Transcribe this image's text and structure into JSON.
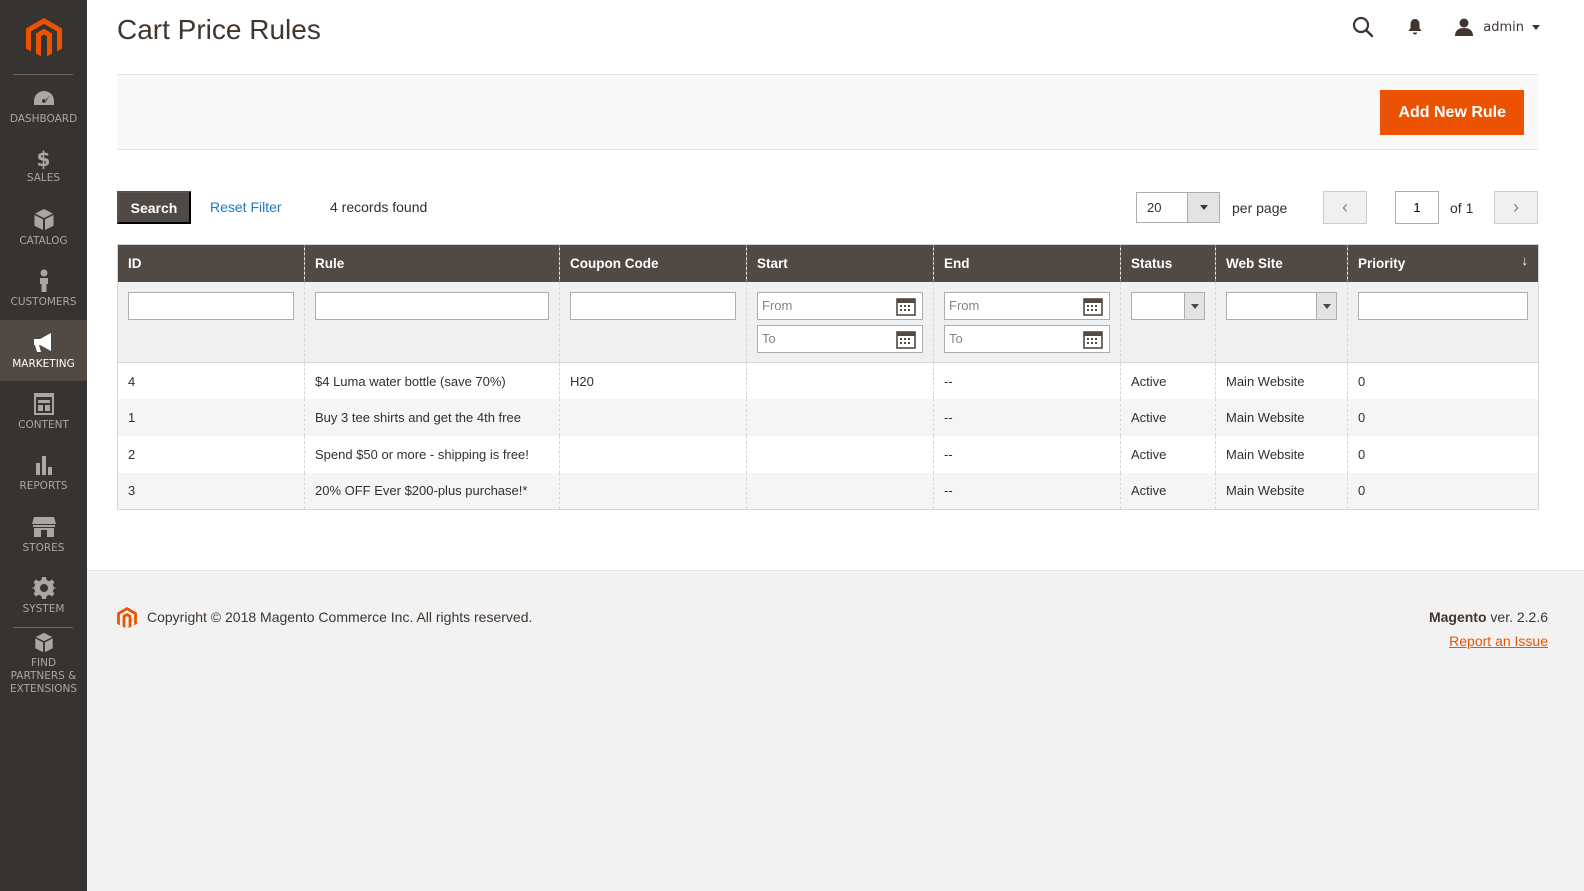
{
  "sidebar": {
    "items": [
      {
        "label": "DASHBOARD",
        "icon": "dashboard-icon"
      },
      {
        "label": "SALES",
        "icon": "dollar-icon"
      },
      {
        "label": "CATALOG",
        "icon": "box-icon"
      },
      {
        "label": "CUSTOMERS",
        "icon": "person-icon"
      },
      {
        "label": "MARKETING",
        "icon": "megaphone-icon",
        "active": true
      },
      {
        "label": "CONTENT",
        "icon": "layout-icon"
      },
      {
        "label": "REPORTS",
        "icon": "bar-chart-icon"
      },
      {
        "label": "STORES",
        "icon": "storefront-icon"
      },
      {
        "label": "SYSTEM",
        "icon": "gear-icon"
      },
      {
        "label": "FIND PARTNERS & EXTENSIONS",
        "icon": "extensions-icon"
      }
    ],
    "sales_symbol": "$"
  },
  "header": {
    "title": "Cart Price Rules",
    "user": "admin"
  },
  "actions": {
    "add_new_rule": "Add New Rule"
  },
  "toolbar": {
    "search": "Search",
    "reset_filter": "Reset Filter",
    "records_found": "4 records found",
    "per_page_value": "20",
    "per_page_label": "per page",
    "current_page": "1",
    "page_of": "of 1",
    "prev": "‹",
    "next": "›"
  },
  "grid": {
    "columns": [
      "ID",
      "Rule",
      "Coupon Code",
      "Start",
      "End",
      "Status",
      "Web Site",
      "Priority"
    ],
    "sort_indicator": "↓",
    "filters": {
      "from_placeholder": "From",
      "to_placeholder": "To"
    },
    "rows": [
      {
        "id": "4",
        "rule": "$4 Luma water bottle (save 70%)",
        "coupon": "H20",
        "start": "",
        "end": "--",
        "status": "Active",
        "website": "Main Website",
        "priority": "0"
      },
      {
        "id": "1",
        "rule": "Buy 3 tee shirts and get the 4th free",
        "coupon": "",
        "start": "",
        "end": "--",
        "status": "Active",
        "website": "Main Website",
        "priority": "0"
      },
      {
        "id": "2",
        "rule": "Spend $50 or more - shipping is free!",
        "coupon": "",
        "start": "",
        "end": "--",
        "status": "Active",
        "website": "Main Website",
        "priority": "0"
      },
      {
        "id": "3",
        "rule": "20% OFF Ever $200-plus purchase!*",
        "coupon": "",
        "start": "",
        "end": "--",
        "status": "Active",
        "website": "Main Website",
        "priority": "0"
      }
    ]
  },
  "footer": {
    "copyright": "Copyright © 2018 Magento Commerce Inc. All rights reserved.",
    "brand": "Magento",
    "version": " ver. 2.2.6",
    "report_issue": "Report an Issue"
  },
  "colors": {
    "accent": "#eb5202",
    "sidebar_bg": "#373330",
    "header_bg": "#514943",
    "link": "#1979c3"
  }
}
